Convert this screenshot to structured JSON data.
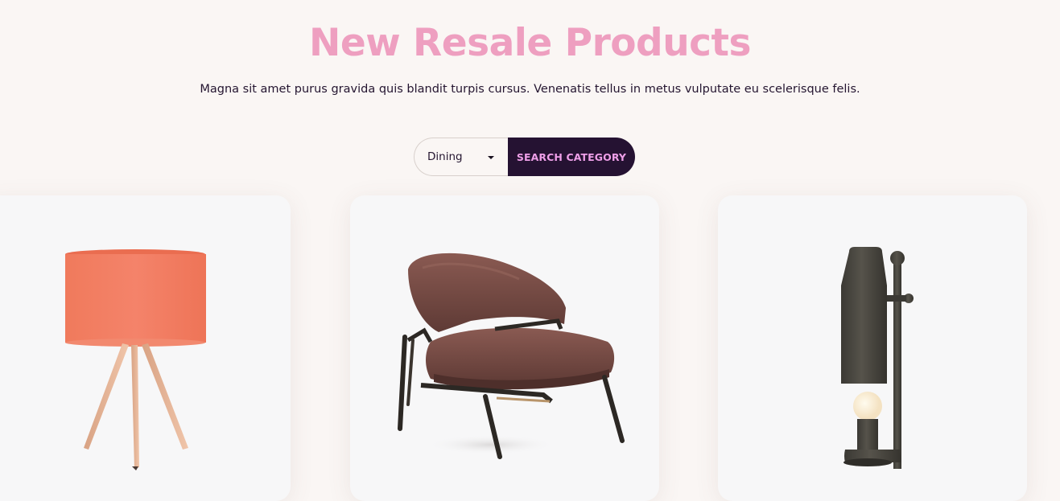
{
  "header": {
    "title": "New Resale Products",
    "subtitle": "Magna sit amet purus gravida quis blandit turpis cursus. Venenatis tellus in metus vulputate eu scelerisque felis."
  },
  "filter": {
    "selected_category": "Dining",
    "button_label": "SEARCH CATEGORY"
  },
  "products": [
    {
      "image": "orange-tripod-table-lamp"
    },
    {
      "image": "brown-upholstered-lounge-chair"
    },
    {
      "image": "dark-metal-table-lamp"
    }
  ],
  "colors": {
    "title": "#ee9fc0",
    "text": "#241530",
    "button_bg": "#251232",
    "button_text": "#ee9fe8",
    "page_bg": "#faf6f4"
  }
}
